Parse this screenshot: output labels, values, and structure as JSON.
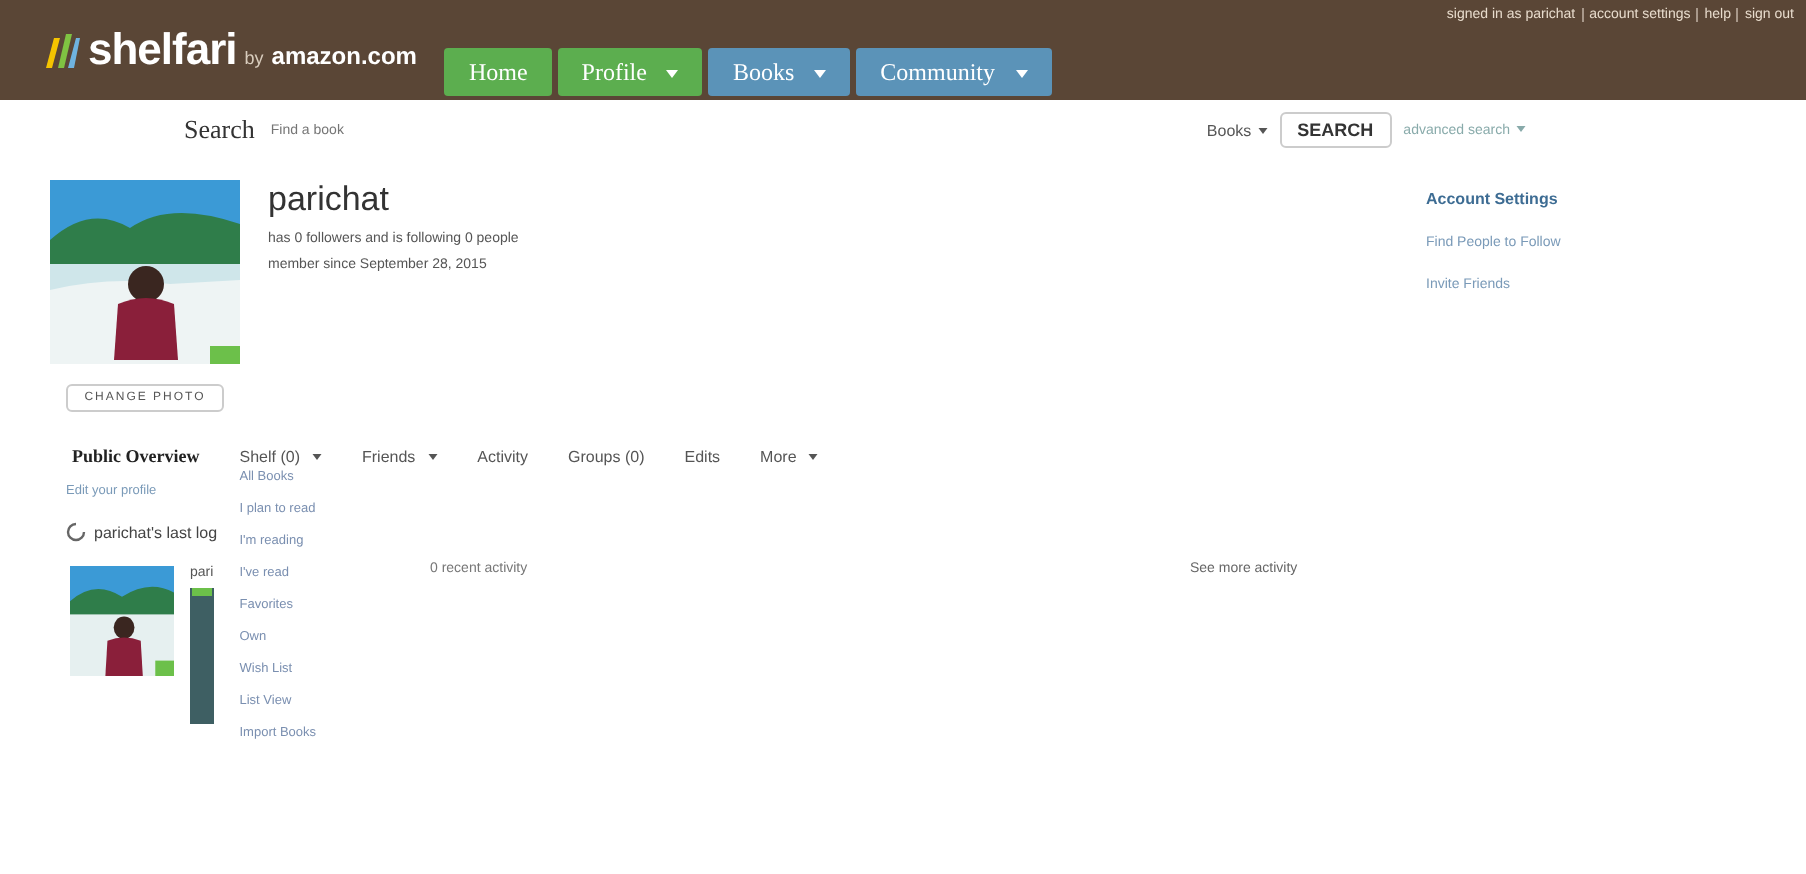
{
  "header": {
    "logo": "shelfari",
    "by": "by",
    "partner": "amazon.com",
    "nav": [
      {
        "label": "Home",
        "caret": false,
        "color": "#5cae4f"
      },
      {
        "label": "Profile",
        "caret": true,
        "color": "#5cae4f"
      },
      {
        "label": "Books",
        "caret": true,
        "color": "#5b93b8"
      },
      {
        "label": "Community",
        "caret": true,
        "color": "#5b93b8"
      }
    ],
    "account_links": [
      "signed in as parichat",
      "account settings",
      "help",
      "sign out"
    ]
  },
  "search": {
    "label": "Search",
    "placeholder": "Find a book",
    "scope": "Books",
    "button": "SEARCH",
    "advanced": "advanced search"
  },
  "profile": {
    "name": "parichat",
    "stats": "has 0 followers and is following 0 people",
    "member_since": "member since September 28, 2015",
    "change_photo": "CHANGE PHOTO"
  },
  "sidebar_links": [
    {
      "label": "Account Settings",
      "bold": true
    },
    {
      "label": "Find People to Follow",
      "bold": false
    },
    {
      "label": "Invite Friends",
      "bold": false
    }
  ],
  "tabs": [
    {
      "label": "Public Overview",
      "selected": true,
      "caret": false
    },
    {
      "label": "Shelf (0)",
      "selected": false,
      "caret": true
    },
    {
      "label": "Friends",
      "selected": false,
      "caret": true
    },
    {
      "label": "Activity",
      "selected": false,
      "caret": false
    },
    {
      "label": "Groups (0)",
      "selected": false,
      "caret": false
    },
    {
      "label": "Edits",
      "selected": false,
      "caret": false
    },
    {
      "label": "More",
      "selected": false,
      "caret": true
    }
  ],
  "edit_profile": "Edit your profile",
  "last_log": "parichat's last log",
  "post_author": "pari",
  "shelf_menu": {
    "expanded": true,
    "items": [
      "All Books",
      "I plan to read",
      "I'm reading",
      "I've read",
      "Favorites",
      "Own",
      "Wish List",
      "List View",
      "Import Books"
    ]
  },
  "recent_activity": "0 recent activity",
  "see_more": "See more activity"
}
